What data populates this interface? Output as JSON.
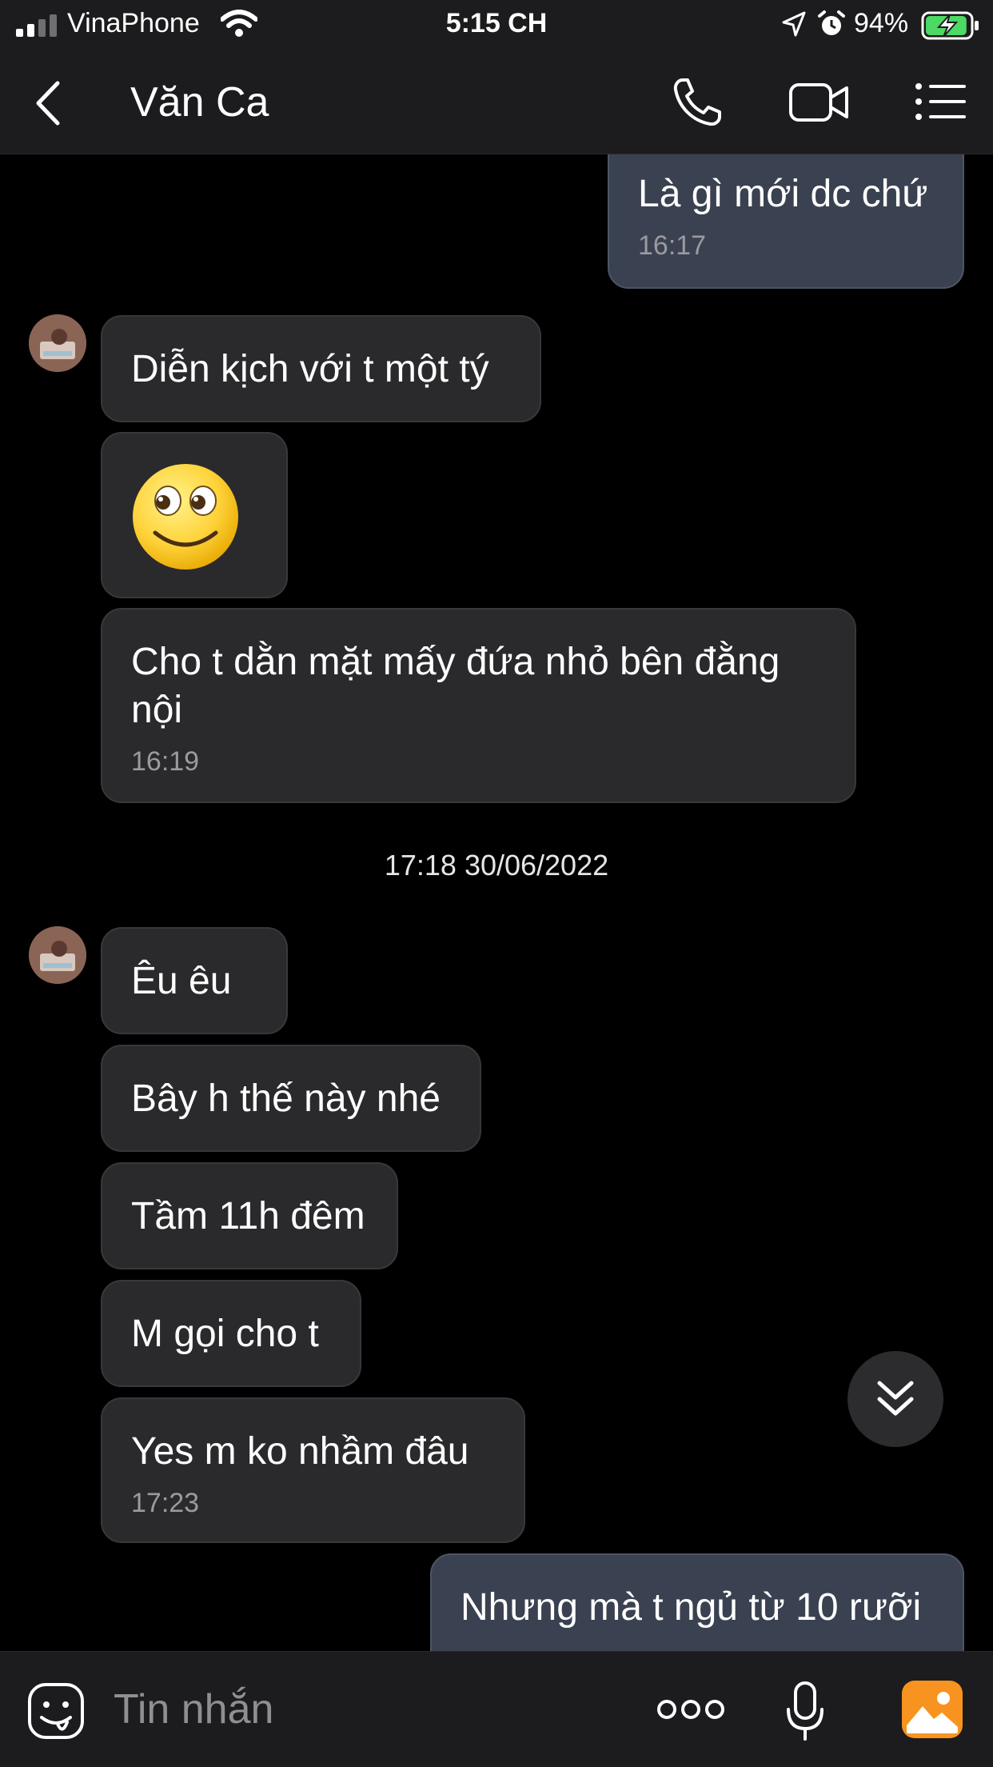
{
  "status_bar": {
    "carrier": "VinaPhone",
    "time": "5:15 CH",
    "battery_percent": "94%",
    "battery_level": 0.94,
    "icons": [
      "signal-icon",
      "wifi-icon",
      "location-icon",
      "alarm-icon",
      "battery-charging-icon"
    ]
  },
  "header": {
    "contact_name": "Văn Ca",
    "icons": [
      "back-chevron-icon",
      "phone-icon",
      "video-camera-icon",
      "list-menu-icon"
    ]
  },
  "messages": [
    {
      "direction": "out",
      "text": "Là gì mới dc chứ",
      "time": "16:17"
    },
    {
      "direction": "in",
      "text": "Diễn kịch với t một tý"
    },
    {
      "direction": "in",
      "sticker": "smiling-face-sticker"
    },
    {
      "direction": "in",
      "text": "Cho t dằn mặt mấy đứa nhỏ bên đằng nội",
      "time": "16:19"
    },
    {
      "type": "date_separator",
      "text": "17:18 30/06/2022"
    },
    {
      "direction": "in",
      "text": "Êu êu"
    },
    {
      "direction": "in",
      "text": "Bây h thế này nhé"
    },
    {
      "direction": "in",
      "text": "Tầm 11h đêm"
    },
    {
      "direction": "in",
      "text": "M gọi cho t"
    },
    {
      "direction": "in",
      "text": "Yes m ko nhầm đâu",
      "time": "17:23"
    },
    {
      "direction": "out",
      "text": "Nhưng mà t ngủ từ 10 rưỡi"
    }
  ],
  "composer": {
    "placeholder": "Tin nhắn",
    "icons": [
      "sticker-icon",
      "more-dots-icon",
      "microphone-icon",
      "gallery-icon"
    ]
  },
  "colors": {
    "background": "#000000",
    "bar_background": "#1c1c1e",
    "incoming_bubble": "#2a2a2c",
    "outgoing_bubble": "#3a4150",
    "battery_green": "#4cd964",
    "gallery_orange": "#f7931e"
  }
}
